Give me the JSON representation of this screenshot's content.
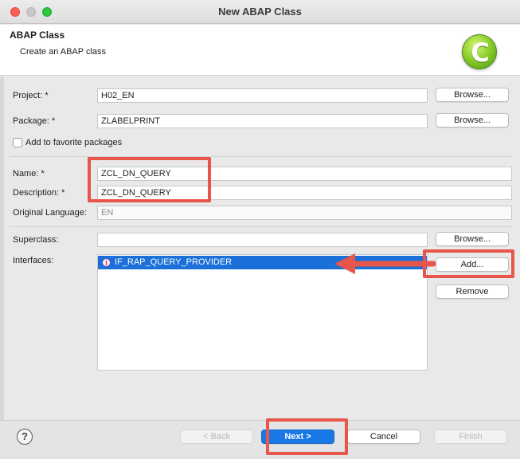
{
  "window": {
    "title": "New ABAP Class"
  },
  "header": {
    "title": "ABAP Class",
    "description": "Create an ABAP class",
    "logo_icon": "abap-class-c-icon",
    "logo_letter": "C"
  },
  "form": {
    "project": {
      "label": "Project: *",
      "value": "H02_EN",
      "browse_label": "Browse..."
    },
    "package": {
      "label": "Package: *",
      "value": "ZLABELPRINT",
      "browse_label": "Browse..."
    },
    "favorite": {
      "label": "Add to favorite packages",
      "checked": false
    },
    "name": {
      "label": "Name: *",
      "value": "ZCL_DN_QUERY"
    },
    "description": {
      "label": "Description: *",
      "value": "ZCL_DN_QUERY"
    },
    "original_language": {
      "label": "Original Language:",
      "value": "EN"
    },
    "superclass": {
      "label": "Superclass:",
      "value": "",
      "browse_label": "Browse..."
    },
    "interfaces": {
      "label": "Interfaces:",
      "items": [
        {
          "name": "IF_RAP_QUERY_PROVIDER",
          "icon": "interface-icon",
          "icon_letter": "I",
          "selected": true
        }
      ],
      "add_label": "Add...",
      "remove_label": "Remove"
    }
  },
  "footer": {
    "help_symbol": "?",
    "back_label": "< Back",
    "next_label": "Next >",
    "cancel_label": "Cancel",
    "finish_label": "Finish"
  },
  "colors": {
    "annotation": "#e8554a",
    "selection": "#1a6fd8",
    "primary_button": "#1a78e6",
    "logo_green": "#8fcf2c"
  }
}
